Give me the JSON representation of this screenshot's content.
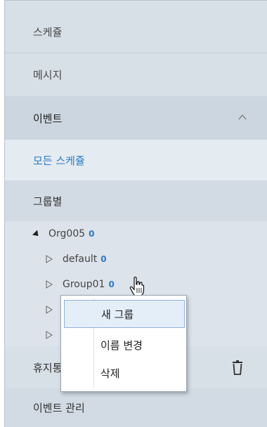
{
  "menu": {
    "schedule": "스케쥴",
    "message": "메시지",
    "event": "이벤트",
    "all_schedules": "모든 스케쥴",
    "by_group": "그룹별",
    "trash": "휴지통",
    "event_management": "이벤트 관리"
  },
  "tree": {
    "org": {
      "label": "Org005",
      "count": "0"
    },
    "groups": [
      {
        "label": "default",
        "count": "0"
      },
      {
        "label": "Group01",
        "count": "0"
      }
    ]
  },
  "context_menu": {
    "items": [
      "새 그룹",
      "이름 변경",
      "삭제"
    ],
    "selected_index": 0
  },
  "colors": {
    "panel_bg": "#d7dfe7",
    "accent_blue": "#2c7bc4",
    "selected_item_bg": "#e4eef8"
  }
}
